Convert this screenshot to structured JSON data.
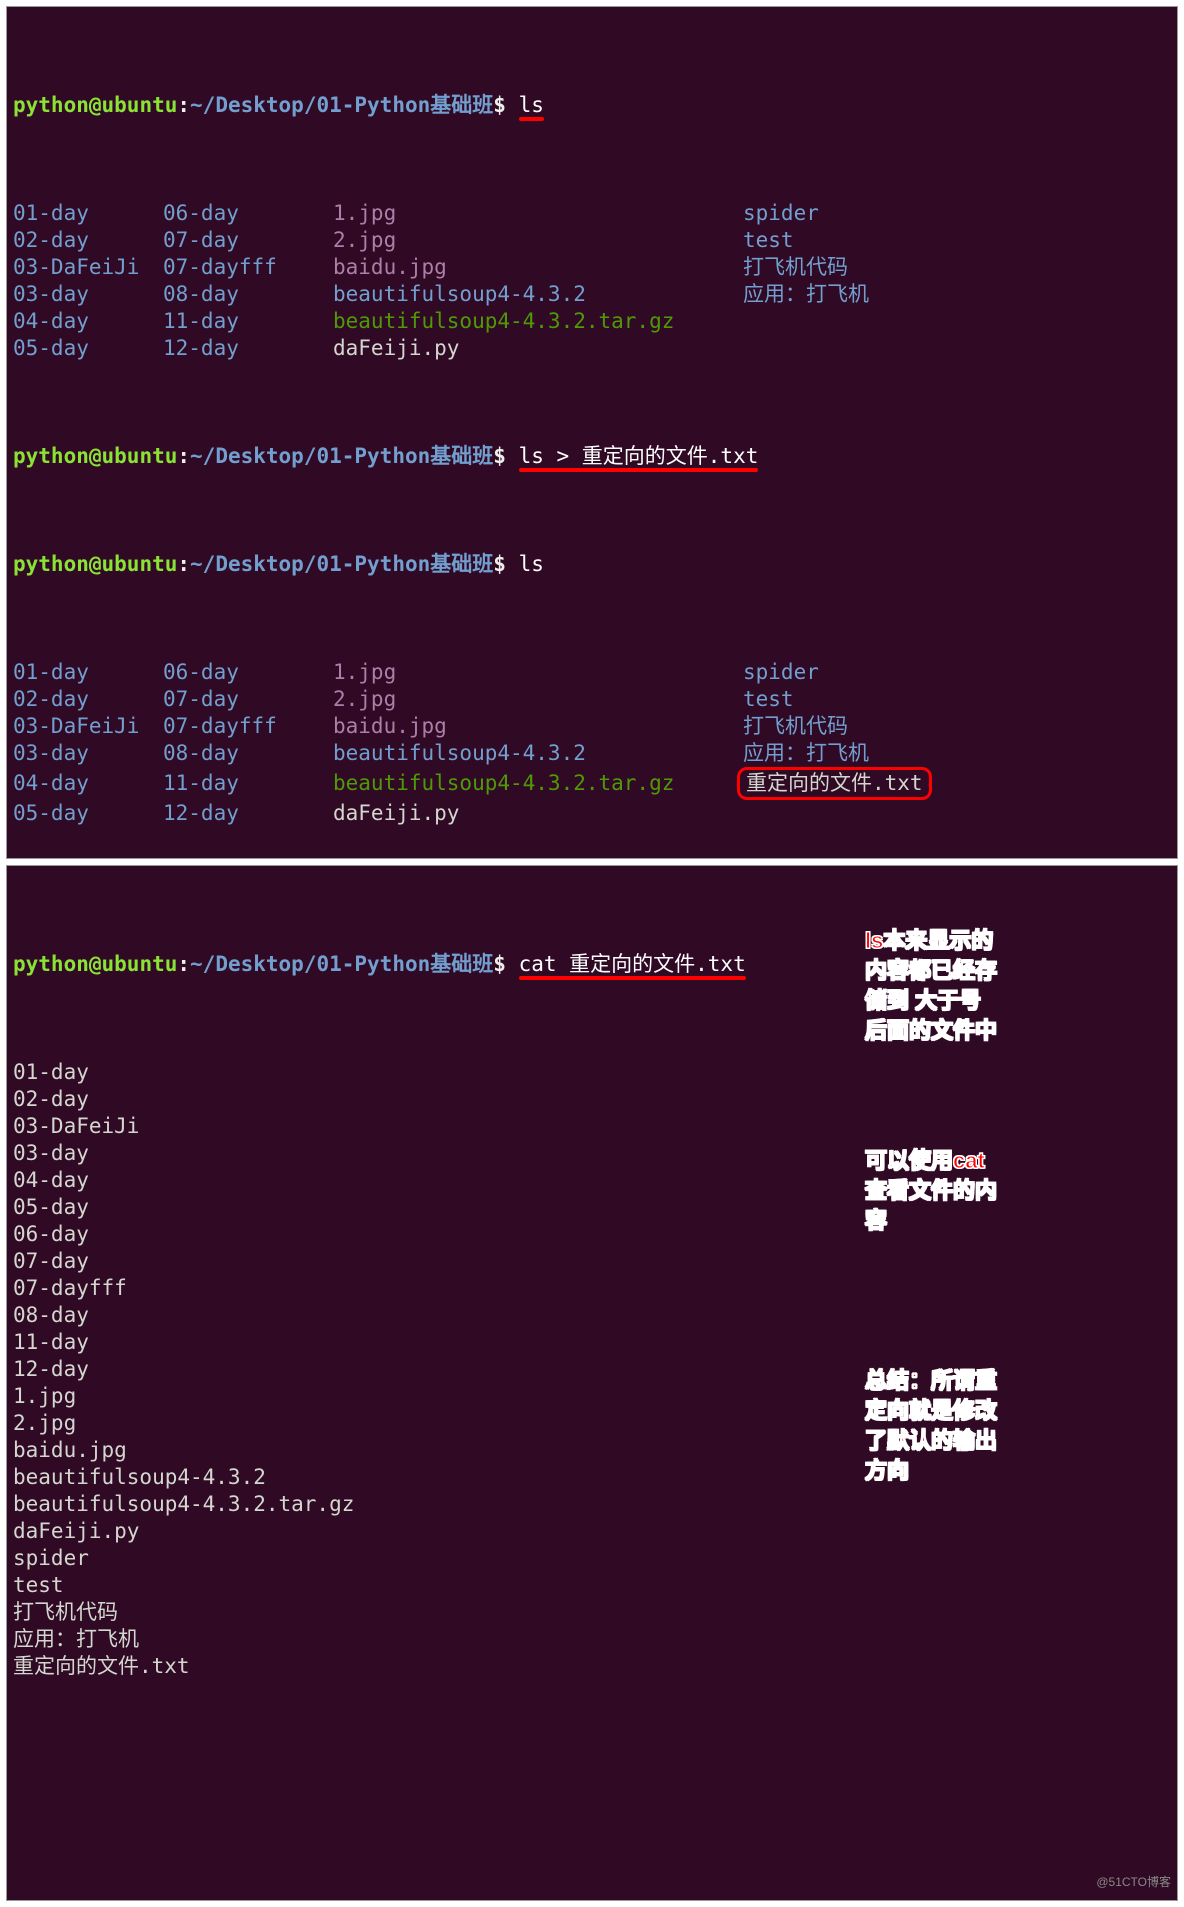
{
  "prompt": {
    "user": "python",
    "at": "@",
    "host": "ubuntu",
    "colon": ":",
    "path_ascii": "~/Desktop/01-Python",
    "path_cjk": "基础班",
    "dollar": "$"
  },
  "commands": {
    "cmd1": "ls",
    "cmd2": "ls > 重定向的文件.txt",
    "cmd3": "ls",
    "cmd4": "cat 重定向的文件.txt"
  },
  "ls_output_1": {
    "rows": [
      {
        "c1": {
          "t": "01-day",
          "k": "dir"
        },
        "c2": {
          "t": "06-day",
          "k": "dir"
        },
        "c3": {
          "t": "1.jpg",
          "k": "jpg"
        },
        "c4": {
          "t": "spider",
          "k": "dir"
        }
      },
      {
        "c1": {
          "t": "02-day",
          "k": "dir"
        },
        "c2": {
          "t": "07-day",
          "k": "dir"
        },
        "c3": {
          "t": "2.jpg",
          "k": "jpg"
        },
        "c4": {
          "t": "test",
          "k": "dir"
        }
      },
      {
        "c1": {
          "t": "03-DaFeiJi",
          "k": "dir"
        },
        "c2": {
          "t": "07-dayfff",
          "k": "dir"
        },
        "c3": {
          "t": "baidu.jpg",
          "k": "jpg"
        },
        "c4": {
          "t": "打飞机代码",
          "k": "dir"
        }
      },
      {
        "c1": {
          "t": "03-day",
          "k": "dir"
        },
        "c2": {
          "t": "08-day",
          "k": "dir"
        },
        "c3": {
          "t": "beautifulsoup4-4.3.2",
          "k": "dir"
        },
        "c4": {
          "t": "应用：打飞机",
          "k": "dir"
        }
      },
      {
        "c1": {
          "t": "04-day",
          "k": "dir"
        },
        "c2": {
          "t": "11-day",
          "k": "dir"
        },
        "c3": {
          "t": "beautifulsoup4-4.3.2.tar.gz",
          "k": "gz"
        },
        "c4": {
          "t": "",
          "k": "plain"
        }
      },
      {
        "c1": {
          "t": "05-day",
          "k": "dir"
        },
        "c2": {
          "t": "12-day",
          "k": "dir"
        },
        "c3": {
          "t": "daFeiji.py",
          "k": "plain"
        },
        "c4": {
          "t": "",
          "k": "plain"
        }
      }
    ]
  },
  "ls_output_2": {
    "rows": [
      {
        "c1": {
          "t": "01-day",
          "k": "dir"
        },
        "c2": {
          "t": "06-day",
          "k": "dir"
        },
        "c3": {
          "t": "1.jpg",
          "k": "jpg"
        },
        "c4": {
          "t": "spider",
          "k": "dir"
        }
      },
      {
        "c1": {
          "t": "02-day",
          "k": "dir"
        },
        "c2": {
          "t": "07-day",
          "k": "dir"
        },
        "c3": {
          "t": "2.jpg",
          "k": "jpg"
        },
        "c4": {
          "t": "test",
          "k": "dir"
        }
      },
      {
        "c1": {
          "t": "03-DaFeiJi",
          "k": "dir"
        },
        "c2": {
          "t": "07-dayfff",
          "k": "dir"
        },
        "c3": {
          "t": "baidu.jpg",
          "k": "jpg"
        },
        "c4": {
          "t": "打飞机代码",
          "k": "dir"
        }
      },
      {
        "c1": {
          "t": "03-day",
          "k": "dir"
        },
        "c2": {
          "t": "08-day",
          "k": "dir"
        },
        "c3": {
          "t": "beautifulsoup4-4.3.2",
          "k": "dir"
        },
        "c4": {
          "t": "应用：打飞机",
          "k": "dir"
        }
      },
      {
        "c1": {
          "t": "04-day",
          "k": "dir"
        },
        "c2": {
          "t": "11-day",
          "k": "dir"
        },
        "c3": {
          "t": "beautifulsoup4-4.3.2.tar.gz",
          "k": "gz"
        },
        "c4": {
          "t": "重定向的文件.txt",
          "k": "plain",
          "hl": true
        }
      },
      {
        "c1": {
          "t": "05-day",
          "k": "dir"
        },
        "c2": {
          "t": "12-day",
          "k": "dir"
        },
        "c3": {
          "t": "daFeiji.py",
          "k": "plain"
        },
        "c4": {
          "t": "",
          "k": "plain"
        }
      }
    ]
  },
  "cat_output": [
    "01-day",
    "02-day",
    "03-DaFeiJi",
    "03-day",
    "04-day",
    "05-day",
    "06-day",
    "07-day",
    "07-dayfff",
    "08-day",
    "11-day",
    "12-day",
    "1.jpg",
    "2.jpg",
    "baidu.jpg",
    "beautifulsoup4-4.3.2",
    "beautifulsoup4-4.3.2.tar.gz",
    "daFeiji.py",
    "spider",
    "test",
    "打飞机代码",
    "应用：打飞机",
    "重定向的文件.txt"
  ],
  "annotations": {
    "a1": "ls本来显示的\n内容都已经存\n储到   大于号\n后面的文件中",
    "a2": "可以使用cat\n查看文件的内\n容",
    "a3": "总结：所谓重\n定向就是修改\n了默认的输出\n方向"
  },
  "watermark": "@51CTO博客",
  "colors": {
    "bg": "#300a24",
    "dir": "#729fcf",
    "jpg": "#ad7fa8",
    "gz": "#4e9a06",
    "plain": "#d3d7cf",
    "prompt_green": "#8ae234",
    "prompt_green2": "#4e9a06",
    "red": "#ff0000"
  }
}
